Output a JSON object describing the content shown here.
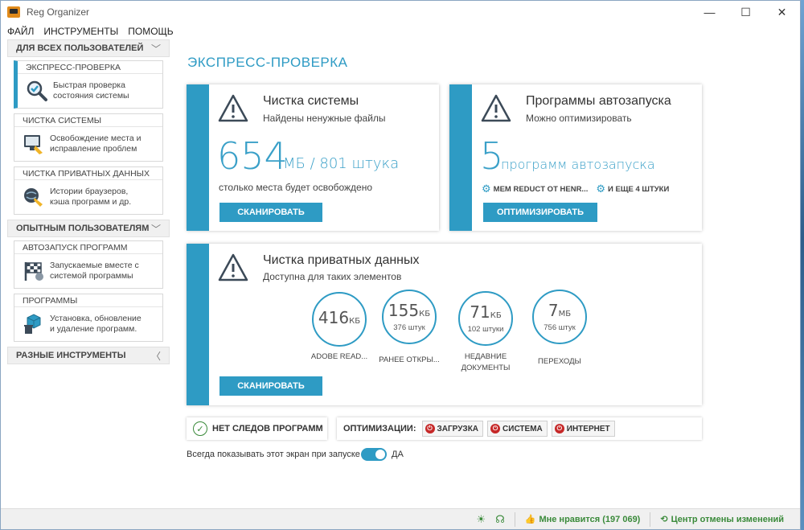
{
  "window": {
    "title": "Reg Organizer",
    "minimize": "—",
    "maximize": "☐",
    "close": "✕"
  },
  "menu": [
    "ФАЙЛ",
    "ИНСТРУМЕНТЫ",
    "ПОМОЩЬ"
  ],
  "sidebar": {
    "sections": [
      {
        "title": "ДЛЯ ВСЕХ ПОЛЬЗОВАТЕЛЕЙ",
        "chevron": "﹀"
      },
      {
        "title": "ОПЫТНЫМ ПОЛЬЗОВАТЕЛЯМ",
        "chevron": "﹀"
      },
      {
        "title": "РАЗНЫЕ ИНСТРУМЕНТЫ",
        "chevron": "〈"
      }
    ],
    "items": [
      {
        "title": "ЭКСПРЕСС-ПРОВЕРКА",
        "line1": "Быстрая проверка",
        "line2": "состояния системы"
      },
      {
        "title": "ЧИСТКА СИСТЕМЫ",
        "line1": "Освобождение места и",
        "line2": "исправление проблем"
      },
      {
        "title": "ЧИСТКА ПРИВАТНЫХ ДАННЫХ",
        "line1": "Истории браузеров,",
        "line2": "кэша программ и др."
      },
      {
        "title": "АВТОЗАПУСК ПРОГРАММ",
        "line1": "Запускаемые вместе с",
        "line2": "системой программы"
      },
      {
        "title": "ПРОГРАММЫ",
        "line1": "Установка, обновление",
        "line2": "и удаление программ."
      }
    ]
  },
  "main": {
    "title": "ЭКСПРЕСС-ПРОВЕРКА",
    "system_clean": {
      "title": "Чистка системы",
      "subtitle": "Найдены ненужные файлы",
      "big_value": "654",
      "big_unit": "МБ / 801 штука",
      "note": "столько места будет освобождено",
      "button": "СКАНИРОВАТЬ"
    },
    "autorun": {
      "title": "Программы автозапуска",
      "subtitle": "Можно оптимизировать",
      "big_value": "5",
      "big_unit": "программ автозапуска",
      "item1": "MEM REDUCT OT HENR...",
      "item2": "И ЕЩЕ 4 ШТУКИ",
      "button": "ОПТИМИЗИРОВАТЬ"
    },
    "private": {
      "title": "Чистка приватных данных",
      "subtitle": "Доступна для таких элементов",
      "button": "СКАНИРОВАТЬ",
      "circles": [
        {
          "value": "416",
          "unit": "КБ",
          "count": "",
          "label": "ADOBE READ..."
        },
        {
          "value": "155",
          "unit": "КБ",
          "count": "376 штук",
          "label": "РАНЕЕ ОТКРЫ..."
        },
        {
          "value": "71",
          "unit": "КБ",
          "count": "102 штуки",
          "label": "НЕДАВНИЕ ДОКУМЕНТЫ"
        },
        {
          "value": "7",
          "unit": "МБ",
          "count": "756 штук",
          "label": "ПЕРЕХОДЫ"
        }
      ]
    },
    "no_traces": "НЕТ СЛЕДОВ ПРОГРАММ",
    "optimizations": {
      "label": "ОПТИМИЗАЦИИ:",
      "items": [
        "ЗАГРУЗКА",
        "СИСТЕМА",
        "ИНТЕРНЕТ"
      ]
    },
    "always_show": "Всегда показывать этот экран при запуске",
    "toggle_label": "ДА"
  },
  "status": {
    "likes": "Мне нравится (197 069)",
    "undo": "Центр отмены изменений"
  },
  "colors": {
    "accent": "#2e9bc4",
    "danger": "#c62828",
    "ok": "#3a8a3a"
  }
}
